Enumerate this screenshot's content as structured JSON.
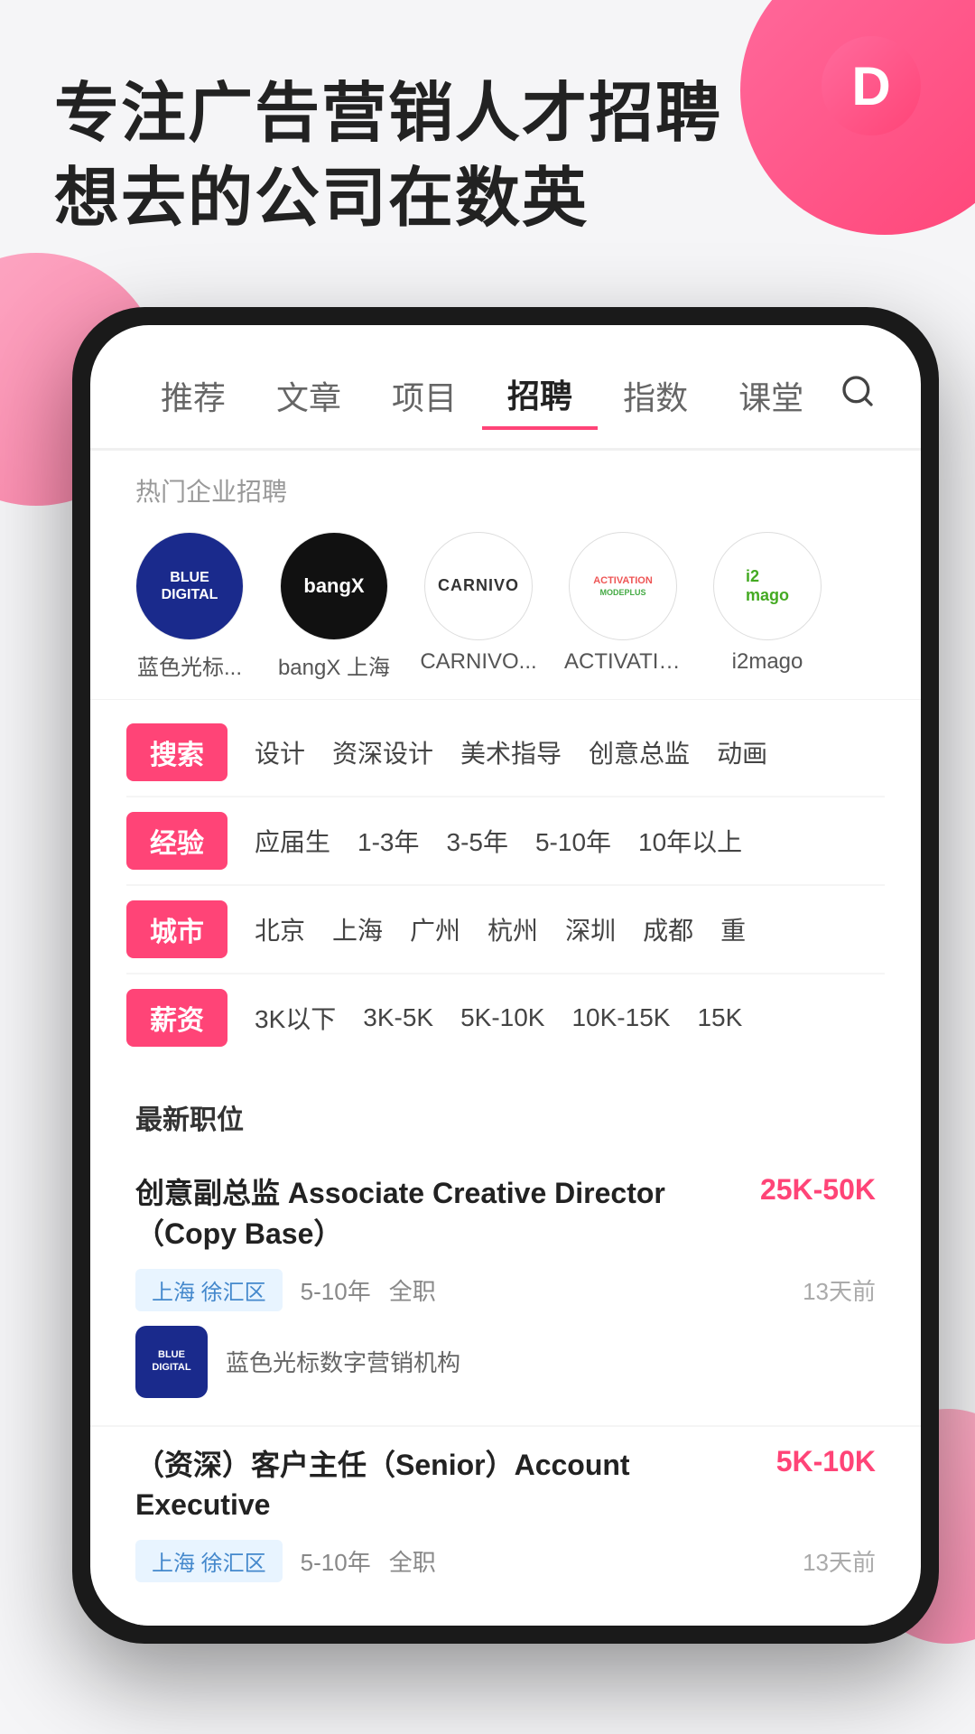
{
  "app": {
    "icon_letter": "D",
    "hero_line1": "专注广告营销人才招聘",
    "hero_line2": "想去的公司在数英"
  },
  "nav": {
    "items": [
      {
        "label": "推荐",
        "active": false
      },
      {
        "label": "文章",
        "active": false
      },
      {
        "label": "项目",
        "active": false
      },
      {
        "label": "招聘",
        "active": true
      },
      {
        "label": "指数",
        "active": false
      },
      {
        "label": "课堂",
        "active": false
      }
    ],
    "search_icon": "🔍"
  },
  "hot_companies": {
    "section_label": "热门企业招聘",
    "items": [
      {
        "name": "蓝色光标...",
        "short": "BLUE\nDIGITAL",
        "type": "blue-digital"
      },
      {
        "name": "bangX 上海",
        "short": "bangX",
        "type": "bangx"
      },
      {
        "name": "CARNIVO...",
        "short": "CARNIVO",
        "type": "carnivo"
      },
      {
        "name": "ACTIVATIO...",
        "short": "ACTIVATION\nMODEPLUS",
        "type": "activation"
      },
      {
        "name": "i2mago",
        "short": "i2\nmago",
        "type": "imago"
      }
    ]
  },
  "filters": [
    {
      "tag": "搜索",
      "options": [
        "设计",
        "资深设计",
        "美术指导",
        "创意总监",
        "动画"
      ]
    },
    {
      "tag": "经验",
      "options": [
        "应届生",
        "1-3年",
        "3-5年",
        "5-10年",
        "10年以上"
      ]
    },
    {
      "tag": "城市",
      "options": [
        "北京",
        "上海",
        "广州",
        "杭州",
        "深圳",
        "成都",
        "重"
      ]
    },
    {
      "tag": "薪资",
      "options": [
        "3K以下",
        "3K-5K",
        "5K-10K",
        "10K-15K",
        "15K"
      ]
    }
  ],
  "latest_jobs": {
    "label": "最新职位",
    "jobs": [
      {
        "title": "创意副总监 Associate Creative Director（Copy Base）",
        "salary": "25K-50K",
        "location": "上海 徐汇区",
        "experience": "5-10年",
        "type": "全职",
        "time": "13天前",
        "company_name": "蓝色光标数字营销机构",
        "company_type": "blue-digital"
      },
      {
        "title": "（资深）客户主任（Senior）Account Executive",
        "salary": "5K-10K",
        "location": "上海 徐汇区",
        "experience": "5-10年",
        "type": "全职",
        "time": "13天前",
        "company_name": "",
        "company_type": ""
      }
    ]
  }
}
